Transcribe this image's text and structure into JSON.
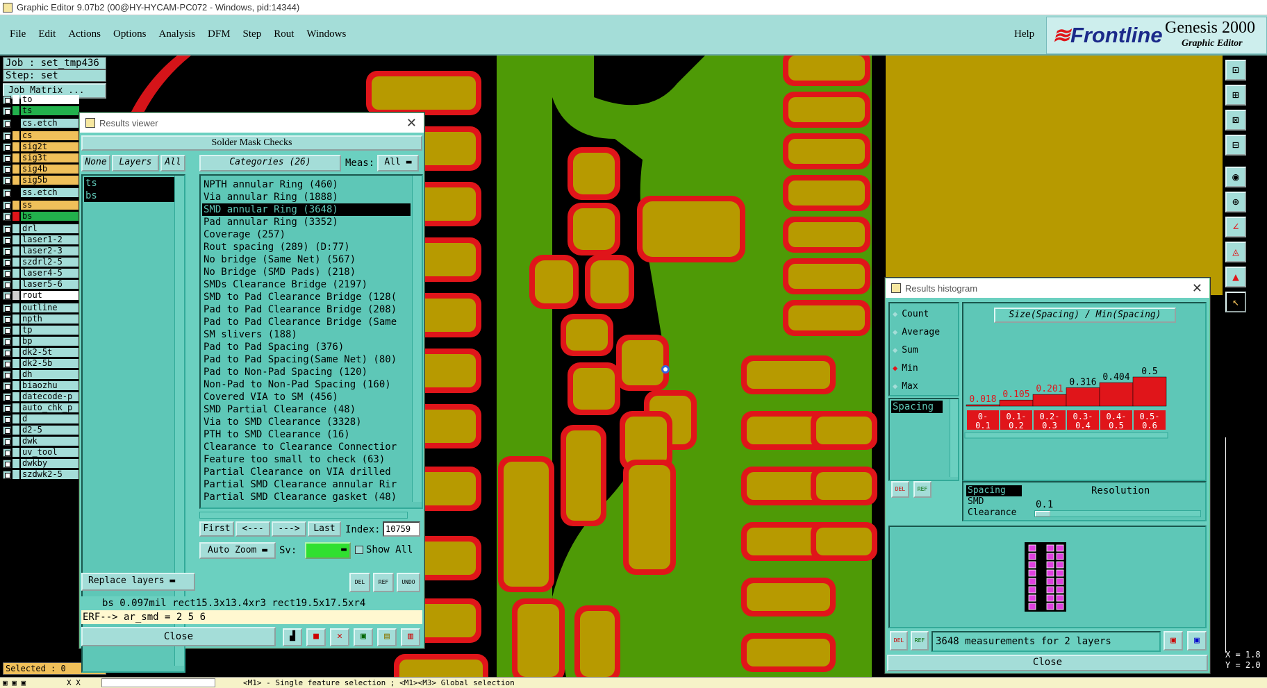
{
  "window": {
    "title": "Graphic Editor 9.07b2 (00@HY-HYCAM-PC072 - Windows, pid:14344)"
  },
  "menu": {
    "items": [
      "File",
      "Edit",
      "Actions",
      "Options",
      "Analysis",
      "DFM",
      "Step",
      "Rout",
      "Windows"
    ],
    "help": "Help"
  },
  "logo": {
    "brand": "Frontline",
    "product": "Genesis 2000",
    "subtitle": "Graphic Editor"
  },
  "job": {
    "job": "Job : set_tmp436",
    "step": "Step: set",
    "matrix_btn": "Job Matrix ..."
  },
  "layers": [
    {
      "name": "to",
      "color": "#ffffff"
    },
    {
      "name": "ts",
      "color": "#22b14c"
    },
    {
      "name": "cs.etch",
      "color": "#000000"
    },
    {
      "name": "cs",
      "color": "#f0c05a"
    },
    {
      "name": "sig2t",
      "color": "#f0c05a"
    },
    {
      "name": "sig3t",
      "color": "#f0c05a"
    },
    {
      "name": "sig4b",
      "color": "#f0c05a"
    },
    {
      "name": "sig5b",
      "color": "#f0c05a"
    },
    {
      "name": "ss.etch",
      "color": "#000000"
    },
    {
      "name": "ss",
      "color": "#f0c05a"
    },
    {
      "name": "bs",
      "color": "#e0151a"
    },
    {
      "name": "drl",
      "color": "#a4ddd8"
    },
    {
      "name": "laser1-2",
      "color": "#a4ddd8"
    },
    {
      "name": "laser2-3",
      "color": "#a4ddd8"
    },
    {
      "name": "szdrl2-5",
      "color": "#a4ddd8"
    },
    {
      "name": "laser4-5",
      "color": "#a4ddd8"
    },
    {
      "name": "laser5-6",
      "color": "#a4ddd8"
    },
    {
      "name": "rout",
      "color": "#d0d0d0"
    },
    {
      "name": "outline",
      "color": "#a4ddd8"
    },
    {
      "name": "npth",
      "color": "#a4ddd8"
    },
    {
      "name": "tp",
      "color": "#a4ddd8"
    },
    {
      "name": "bp",
      "color": "#a4ddd8"
    },
    {
      "name": "dk2-5t",
      "color": "#a4ddd8"
    },
    {
      "name": "dk2-5b",
      "color": "#a4ddd8"
    },
    {
      "name": "dh",
      "color": "#a4ddd8"
    },
    {
      "name": "biaozhu",
      "color": "#a4ddd8"
    },
    {
      "name": "datecode-p",
      "color": "#a4ddd8"
    },
    {
      "name": "auto_chk_p",
      "color": "#a4ddd8"
    },
    {
      "name": "d",
      "color": "#a4ddd8"
    },
    {
      "name": "d2-5",
      "color": "#a4ddd8"
    },
    {
      "name": "dwk",
      "color": "#a4ddd8"
    },
    {
      "name": "uv_tool",
      "color": "#a4ddd8"
    },
    {
      "name": "dwkby",
      "color": "#a4ddd8"
    },
    {
      "name": "szdwk2-5",
      "color": "#a4ddd8"
    }
  ],
  "selected_text": "Selected : 0",
  "results_viewer": {
    "title": "Results viewer",
    "heading": "Solder Mask Checks",
    "none_btn": "None",
    "layers_btn": "Layers",
    "all_btn": "All",
    "layer_items": [
      "ts",
      "bs"
    ],
    "categories_label": "Categories (26)",
    "meas_label": "Meas:",
    "meas_value": "All",
    "categories": [
      "NPTH annular Ring (460)",
      "Via annular Ring (1888)",
      "SMD annular Ring (3648)",
      "Pad annular Ring (3352)",
      "Coverage (257)",
      "Rout spacing (289)        (D:77)",
      "No bridge (Same Net) (567)",
      "No Bridge (SMD Pads) (218)",
      "SMDs Clearance Bridge (2197)",
      "SMD to Pad Clearance Bridge (128(",
      "Pad to Pad Clearance Bridge (208)",
      "Pad to Pad Clearance Bridge (Same",
      "SM slivers (188)",
      "Pad to Pad Spacing (376)",
      "Pad to Pad Spacing(Same Net) (80)",
      "Pad to Non-Pad Spacing (120)",
      "Non-Pad to Non-Pad Spacing (160)",
      "Covered VIA to SM (456)",
      "SMD Partial Clearance (48)",
      "Via to SMD Clearance (3328)",
      "PTH to SMD Clearance (16)",
      "Clearance to Clearance Connectior",
      "Feature too small to check (63)",
      "Partial Clearance on VIA drilled",
      "Partial SMD Clearance annular Rir",
      "Partial SMD Clearance gasket (48)"
    ],
    "nav": {
      "first": "First",
      "prev": "<---",
      "next": "--->",
      "last": "Last",
      "index_label": "Index:",
      "index_value": "10759"
    },
    "auto_zoom": "Auto Zoom",
    "sv_label": "Sv:",
    "show_all": "Show All",
    "replace_layers": "Replace layers",
    "info_line": "bs 0.097mil  rect15.3x13.4xr3  rect19.5x17.5xr4",
    "erf_line": "ERF--> ar_smd = 2 5 6",
    "close": "Close",
    "tool_labels": [
      "DEL",
      "REF",
      "UNDO"
    ]
  },
  "histogram": {
    "title": "Results histogram",
    "options": [
      "Count",
      "Average",
      "Sum",
      "Min",
      "Max"
    ],
    "selected_option": "Min",
    "chart_title": "Size(Spacing) / Min(Spacing)",
    "list_top": [
      "Spacing"
    ],
    "list_bottom": [
      "Spacing",
      "SMD",
      "Clearance"
    ],
    "resolution_label": "Resolution",
    "resolution_value": "0.1",
    "summary": "3648 measurements for 2 layers",
    "close": "Close",
    "tool_labels": [
      "DEL",
      "REF"
    ]
  },
  "chart_data": {
    "type": "bar",
    "title": "Size(Spacing) / Min(Spacing)",
    "categories": [
      "0-0.1",
      "0.1-0.2",
      "0.2-0.3",
      "0.3-0.4",
      "0.4-0.5",
      "0.5-0.6"
    ],
    "values": [
      0.018,
      0.105,
      0.201,
      0.316,
      0.404,
      0.5
    ],
    "value_labels": [
      "0.018",
      "0.105",
      "0.201",
      "0.316",
      "0.404",
      "0.5"
    ],
    "category_labels": [
      [
        "0-",
        "0.1"
      ],
      [
        "0.1-",
        "0.2"
      ],
      [
        "0.2-",
        "0.3"
      ],
      [
        "0.3-",
        "0.4"
      ],
      [
        "0.4-",
        "0.5"
      ],
      [
        "0.5-",
        "0.6"
      ]
    ],
    "ylim": [
      0,
      0.5
    ],
    "color": "#e0151a"
  },
  "colors": {
    "bg": "#a4ddd8",
    "panel": "#6bd0c0",
    "copper": "#b79a00",
    "mask": "#e0151a",
    "board": "#4e9a06"
  },
  "statusbar": {
    "coords": "X X",
    "message": "<M1> - Single feature selection ; <M1><M3> Global selection"
  },
  "coords": {
    "x": "X = 1.8",
    "y": "Y = 2.0"
  }
}
